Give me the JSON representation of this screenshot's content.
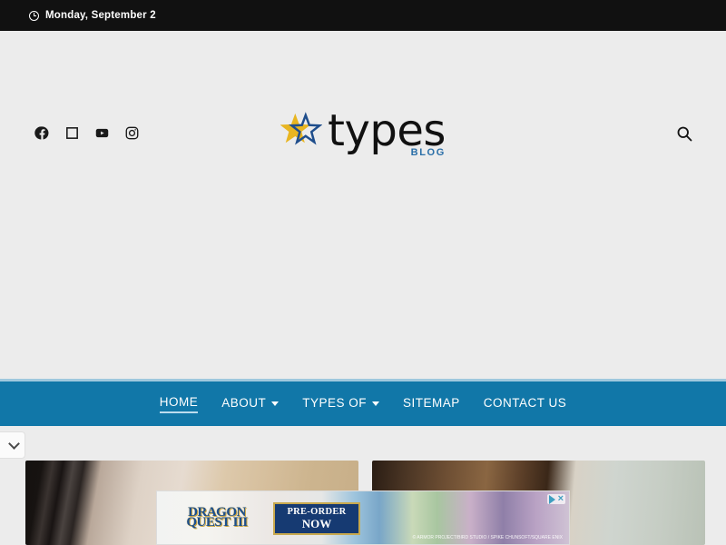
{
  "topbar": {
    "clock_icon": "clock-icon",
    "date": "Monday, September 2"
  },
  "header": {
    "social": [
      {
        "name": "facebook-icon",
        "label": "Facebook"
      },
      {
        "name": "twitter-icon",
        "label": "Twitter"
      },
      {
        "name": "youtube-icon",
        "label": "YouTube"
      },
      {
        "name": "instagram-icon",
        "label": "Instagram"
      }
    ],
    "logo": {
      "star_icon": "star-icon",
      "word": "types",
      "sub": "BLOG",
      "star_gold": "#e8b521",
      "star_blue": "#1f4e8c",
      "sub_color": "#2a6fa8"
    },
    "search": {
      "icon": "search-icon",
      "label": "Search"
    },
    "background_color": "#ececec"
  },
  "nav": {
    "background_color": "#1177a8",
    "border_color": "#9fc8dd",
    "items": [
      {
        "label": "HOME",
        "active": true,
        "caret": false
      },
      {
        "label": "ABOUT",
        "active": false,
        "caret": true
      },
      {
        "label": "TYPES OF",
        "active": false,
        "caret": true
      },
      {
        "label": "SITEMAP",
        "active": false,
        "caret": false
      },
      {
        "label": "CONTACT US",
        "active": false,
        "caret": false
      }
    ]
  },
  "content": {
    "carousel_prev_icon": "chevron-down-icon",
    "cards": [
      {
        "name": "article-card-1"
      },
      {
        "name": "article-card-2"
      }
    ]
  },
  "ad": {
    "brand": "DRAGON QUEST III",
    "cta_line1": "PRE-ORDER",
    "cta_line2": "NOW",
    "credit": "© ARMOR PROJECT/BIRD STUDIO / SPIKE CHUNSOFT/SQUARE ENIX",
    "adchoices_icon": "adchoices-icon",
    "close_label": "×",
    "accent_color": "#3f9fc0"
  }
}
